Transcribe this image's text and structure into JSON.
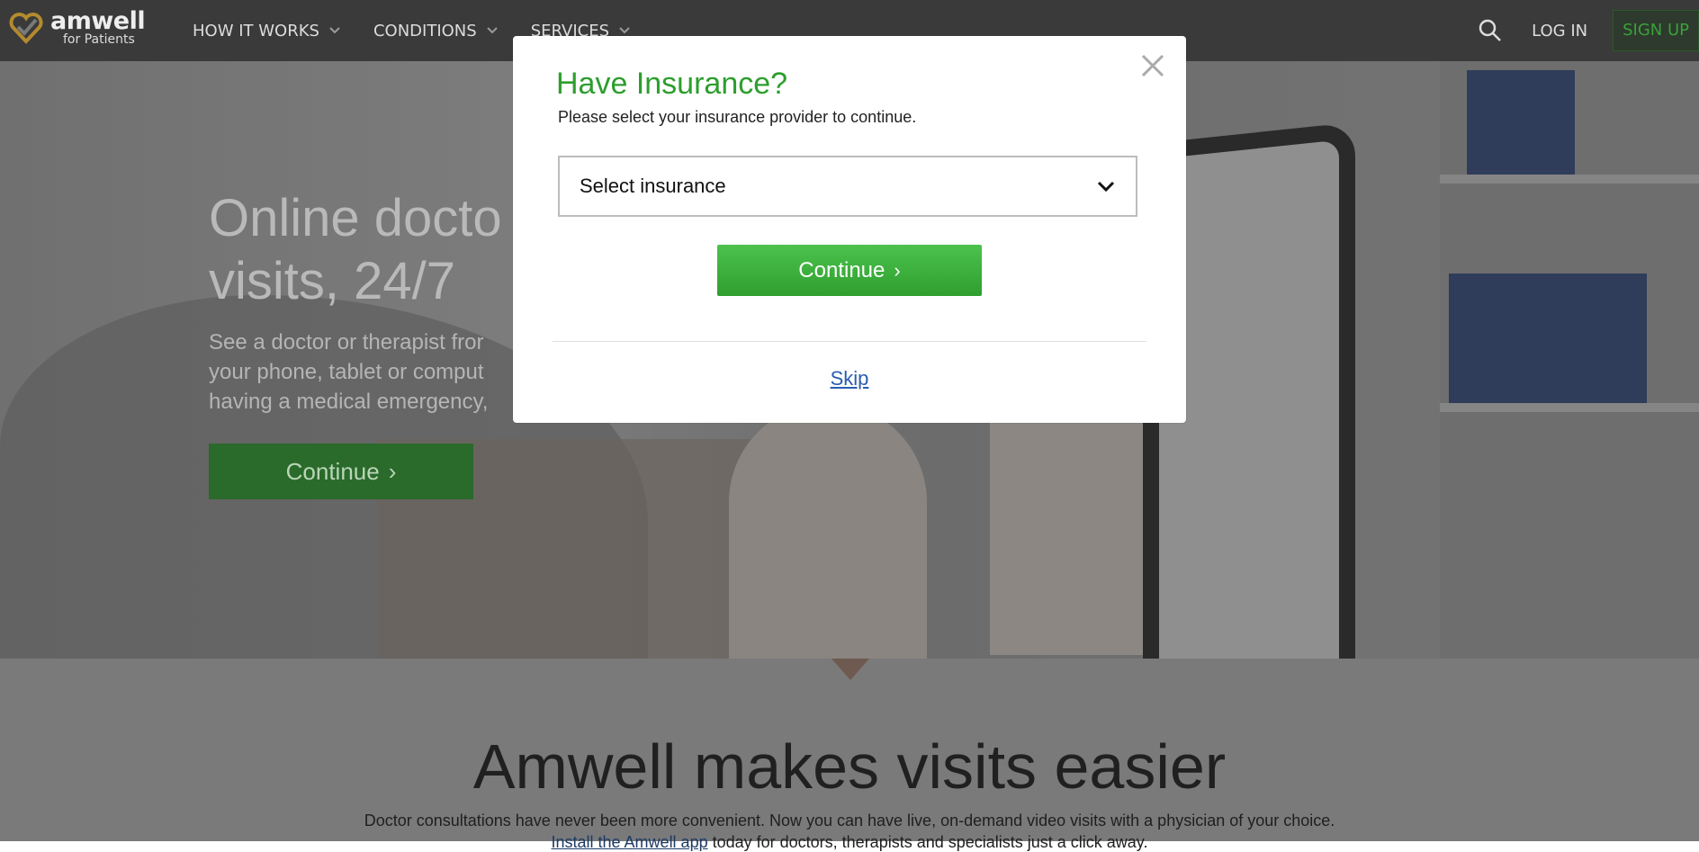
{
  "header": {
    "logo": {
      "name": "amwell",
      "sub": "for Patients"
    },
    "nav": [
      {
        "label": "HOW IT WORKS"
      },
      {
        "label": "CONDITIONS"
      },
      {
        "label": "SERVICES"
      }
    ],
    "login_label": "LOG IN",
    "signup_label": "SIGN UP"
  },
  "hero": {
    "title_line1": "Online docto",
    "title_line2": "visits, 24/7",
    "sub_line1": "See a doctor or therapist fror",
    "sub_line2": "your phone, tablet or comput",
    "sub_line3": "having a medical emergency,",
    "button_label": "Continue"
  },
  "lower": {
    "title": "Amwell makes visits easier",
    "text_line1": "Doctor consultations have never been more convenient. Now you can have live, on-demand video visits with a physician of your choice.",
    "link_text": "Install the Amwell app",
    "text_line2_rest": " today for doctors, therapists and specialists just a click away."
  },
  "modal": {
    "title": "Have Insurance?",
    "subtitle": "Please select your insurance provider to continue.",
    "select_label": "Select insurance",
    "continue_label": "Continue",
    "skip_label": "Skip"
  },
  "colors": {
    "accent_green": "#2d9e2d",
    "link_blue": "#2a5db0",
    "header_bg": "#3a3a3a"
  },
  "icons": [
    "logo-heart-icon",
    "chevron-down-icon",
    "search-icon",
    "close-icon",
    "chevron-right-icon"
  ]
}
